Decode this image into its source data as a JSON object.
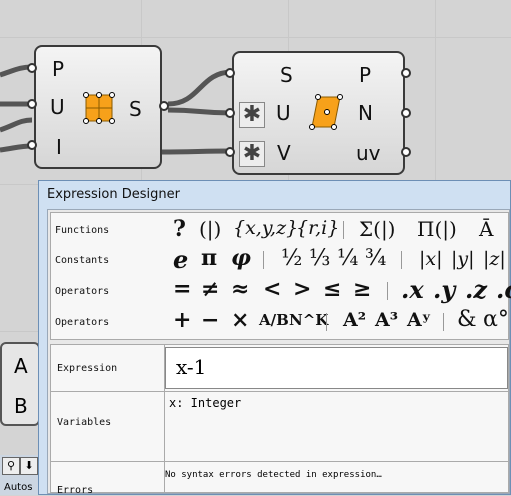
{
  "canvas": {
    "comp1": {
      "inputs": [
        "P",
        "U",
        "I"
      ],
      "output": "S"
    },
    "comp2": {
      "inputs": [
        "S",
        "U",
        "V"
      ],
      "outputs": [
        "P",
        "N",
        "uv"
      ]
    },
    "panel": {
      "lines": [
        "A",
        "B"
      ]
    },
    "status": {
      "label": "Autos"
    }
  },
  "dialog": {
    "title": "Expression Designer",
    "rows": {
      "functions": {
        "label": "Functions",
        "symbols": [
          "?",
          "(|)",
          "{x,y,z}",
          "{r,i}",
          "Σ(|)",
          "Π(|)",
          "Ā"
        ]
      },
      "constants": {
        "label": "Constants",
        "symbols": [
          "e",
          "π",
          "φ",
          "½",
          "⅓",
          "¼",
          "¾",
          "|x|",
          "|y|",
          "|z|"
        ]
      },
      "operators1": {
        "label": "Operators",
        "symbols": [
          "=",
          "≠",
          "≈",
          "<",
          ">",
          "≤",
          "≥",
          ".x",
          ".y",
          ".z",
          ".c"
        ]
      },
      "operators2": {
        "label": "Operators",
        "symbols": [
          "+",
          "−",
          "×",
          "A/B",
          "N^K",
          "A²",
          "A³",
          "Aʸ",
          "&",
          "α°"
        ]
      }
    },
    "fields": {
      "expression": {
        "label": "Expression",
        "value": "x-1"
      },
      "variables": {
        "label": "Variables",
        "value": "x: Integer"
      },
      "errors": {
        "label": "Errors",
        "value": "No syntax errors detected in expression…"
      }
    }
  },
  "colors": {
    "accent": "#f7a11a",
    "dialog_frame": "#cfe0f2",
    "wire": "#555555"
  }
}
